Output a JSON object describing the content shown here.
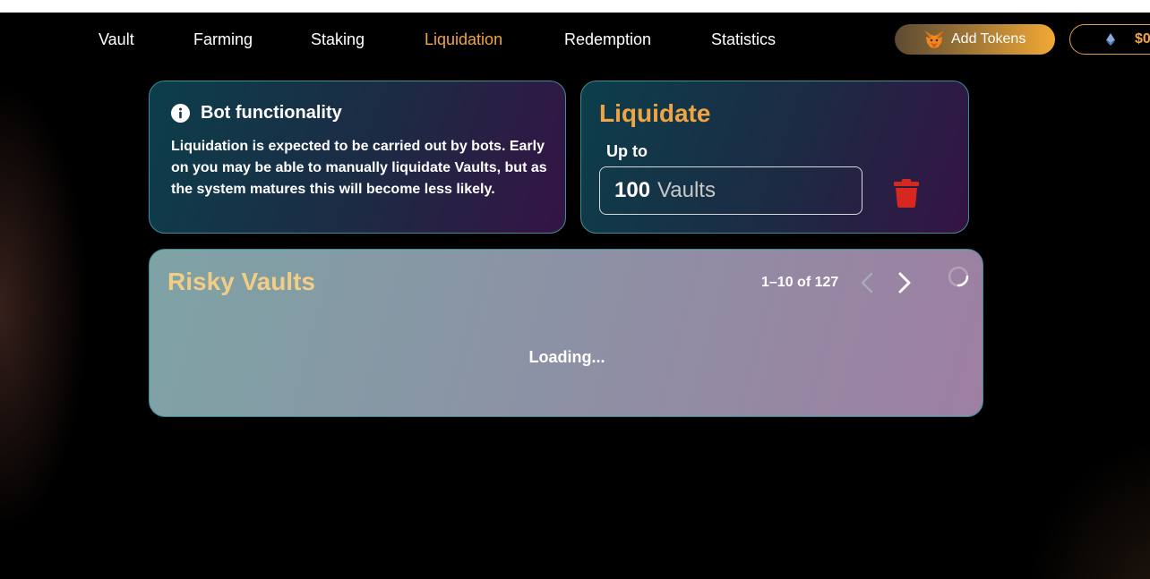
{
  "nav": {
    "items": [
      {
        "label": "Vault"
      },
      {
        "label": "Farming"
      },
      {
        "label": "Staking"
      },
      {
        "label": "Liquidation",
        "active": true
      },
      {
        "label": "Redemption"
      },
      {
        "label": "Statistics"
      }
    ],
    "add_tokens_label": "Add Tokens",
    "wallet_balance": "$0"
  },
  "bot_card": {
    "title": "Bot functionality",
    "body": "Liquidation is expected to be carried out by bots. Early on you may be able to manually liquidate Vaults, but as the system matures this will become less likely."
  },
  "liquidate_card": {
    "title": "Liquidate",
    "up_to_label": "Up to",
    "amount": "100",
    "unit": "Vaults"
  },
  "risky_card": {
    "title": "Risky Vaults",
    "pagination": "1–10 of 127",
    "loading_text": "Loading..."
  },
  "colors": {
    "accent": "#f0a542",
    "risky_title": "#f1cd86",
    "trash": "#d6281e"
  },
  "icons": {
    "info": "info-icon",
    "fox": "metamask-fox-icon",
    "eth": "ethereum-icon",
    "trash": "trash-icon",
    "prev": "chevron-left-icon",
    "next": "chevron-right-icon",
    "spinner": "loading-spinner-icon"
  }
}
